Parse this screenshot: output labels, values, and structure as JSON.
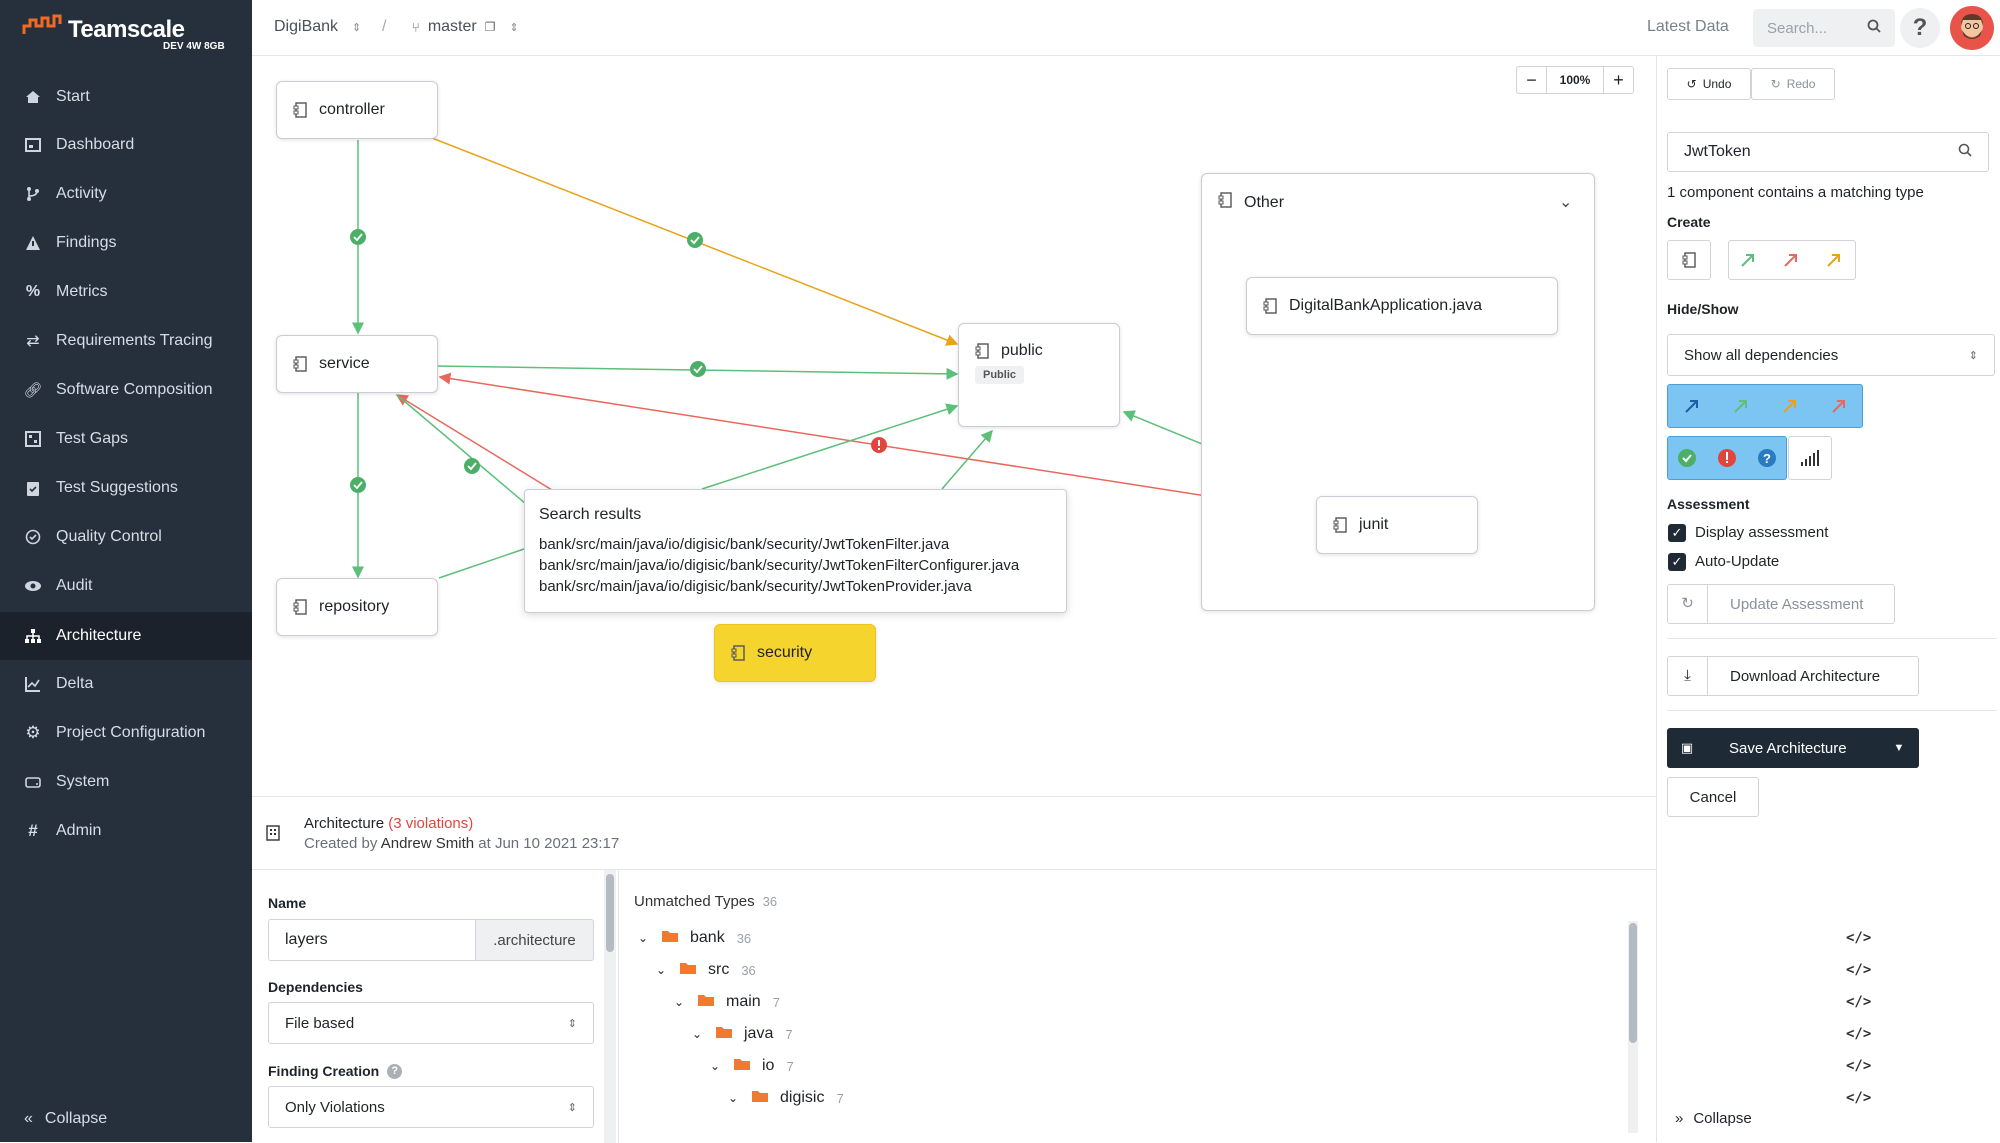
{
  "app": {
    "name": "Teamscale",
    "build": "DEV 4W 8GB"
  },
  "nav": {
    "items": [
      {
        "label": "Start",
        "icon": "home-icon"
      },
      {
        "label": "Dashboard",
        "icon": "dashboard-icon"
      },
      {
        "label": "Activity",
        "icon": "branch-icon"
      },
      {
        "label": "Findings",
        "icon": "warning-icon"
      },
      {
        "label": "Metrics",
        "icon": "percent-icon"
      },
      {
        "label": "Requirements Tracing",
        "icon": "exchange-icon"
      },
      {
        "label": "Software Composition",
        "icon": "link-icon"
      },
      {
        "label": "Test Gaps",
        "icon": "test-gaps-icon"
      },
      {
        "label": "Test Suggestions",
        "icon": "clipboard-icon"
      },
      {
        "label": "Quality Control",
        "icon": "check-circle-icon"
      },
      {
        "label": "Audit",
        "icon": "eye-icon"
      },
      {
        "label": "Architecture",
        "icon": "sitemap-icon"
      },
      {
        "label": "Delta",
        "icon": "chart-icon"
      },
      {
        "label": "Project Configuration",
        "icon": "cog-icon"
      },
      {
        "label": "System",
        "icon": "hdd-icon"
      },
      {
        "label": "Admin",
        "icon": "hash-icon"
      }
    ],
    "active": "Architecture",
    "collapse_label": "Collapse"
  },
  "topbar": {
    "project": "DigiBank",
    "separator": "/",
    "branch": "master",
    "latest": "Latest Data",
    "search_placeholder": "Search..."
  },
  "canvas": {
    "zoom": "100%",
    "nodes": {
      "controller": "controller",
      "service": "service",
      "repository": "repository",
      "public": "public",
      "public_badge": "Public",
      "other": "Other",
      "digital": "DigitalBankApplication.java",
      "junit": "junit",
      "security": "security"
    },
    "search_results": {
      "title": "Search results",
      "items": [
        "bank/src/main/java/io/digisic/bank/security/JwtTokenFilter.java",
        "bank/src/main/java/io/digisic/bank/security/JwtTokenFilterConfigurer.java",
        "bank/src/main/java/io/digisic/bank/security/JwtTokenProvider.java"
      ]
    }
  },
  "right": {
    "undo": "Undo",
    "redo": "Redo",
    "search_value": "JwtToken",
    "match_text": "1 component contains a matching type",
    "create_label": "Create",
    "hideshow_label": "Hide/Show",
    "deps_select": "Show all dependencies",
    "assessment_label": "Assessment",
    "display_assessment": "Display assessment",
    "auto_update": "Auto-Update",
    "update_assessment": "Update Assessment",
    "download": "Download Architecture",
    "save": "Save Architecture",
    "cancel": "Cancel",
    "collapse": "Collapse",
    "colors": {
      "green": "#5cbf7a",
      "red": "#e8685c",
      "orange": "#e8a318",
      "blue": "#2a7ac0"
    }
  },
  "bottom": {
    "title": "Architecture",
    "violations": "(3 violations)",
    "created_prefix": "Created by",
    "author": "Andrew Smith",
    "date_prefix": "at",
    "date": "Jun 10 2021 23:17",
    "name_label": "Name",
    "name_value": "layers",
    "name_suffix": ".architecture",
    "dependencies_label": "Dependencies",
    "dependencies_value": "File based",
    "finding_label": "Finding Creation",
    "finding_value": "Only Violations",
    "unmatched_label": "Unmatched Types",
    "unmatched_count": "36",
    "tree": [
      {
        "name": "bank",
        "count": "36"
      },
      {
        "name": "src",
        "count": "36"
      },
      {
        "name": "main",
        "count": "7"
      },
      {
        "name": "java",
        "count": "7"
      },
      {
        "name": "io",
        "count": "7"
      },
      {
        "name": "digisic",
        "count": "7"
      }
    ]
  }
}
